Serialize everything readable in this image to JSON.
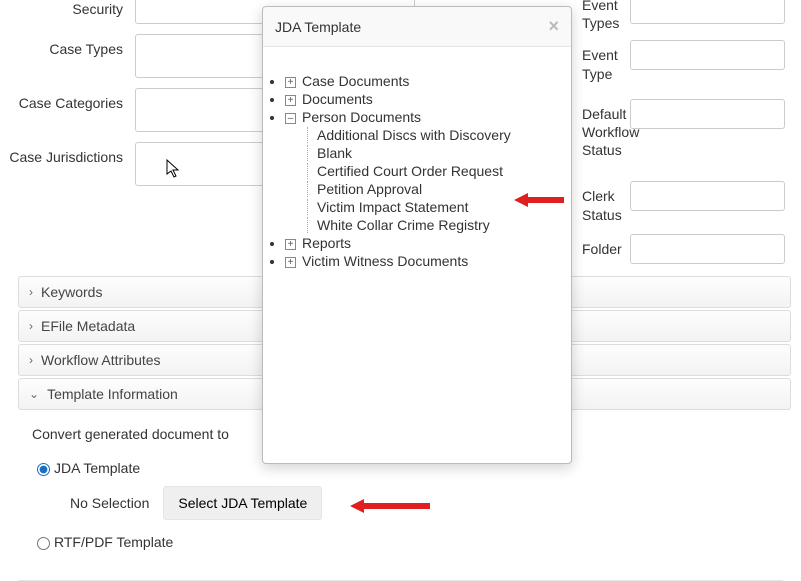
{
  "formLeft": {
    "row0": {
      "label": "Security"
    },
    "caseTypes": {
      "label": "Case Types"
    },
    "caseCategories": {
      "label": "Case Categories"
    },
    "caseJurisdictions": {
      "label": "Case Jurisdictions"
    }
  },
  "formRight": {
    "eventTypes": {
      "label": "Event Types"
    },
    "eventType": {
      "label": "Event Type"
    },
    "defaultWorkflowStatus": {
      "label": "Default Workflow Status"
    },
    "clerkStatus": {
      "label": "Clerk Status"
    },
    "folder": {
      "label": "Folder"
    }
  },
  "accordion": {
    "keywords": "Keywords",
    "efile": "EFile Metadata",
    "workflow": "Workflow Attributes",
    "template": "Template Information"
  },
  "templateInfo": {
    "convertText": "Convert generated document to",
    "radioJda": "JDA Template",
    "noSelection": "No Selection",
    "selectBtn": "Select JDA Template",
    "radioRtf": "RTF/PDF Template"
  },
  "dialog": {
    "title": "JDA Template",
    "tree": {
      "caseDocuments": "Case Documents",
      "documents": "Documents",
      "personDocuments": "Person Documents",
      "personChildren": {
        "addlDiscs": "Additional Discs with Discovery",
        "blank": "Blank",
        "certOrder": "Certified Court Order Request",
        "petition": "Petition Approval",
        "victimImpact": "Victim Impact Statement",
        "whiteCollar": "White Collar Crime Registry"
      },
      "reports": "Reports",
      "victimWitness": "Victim Witness Documents"
    }
  }
}
